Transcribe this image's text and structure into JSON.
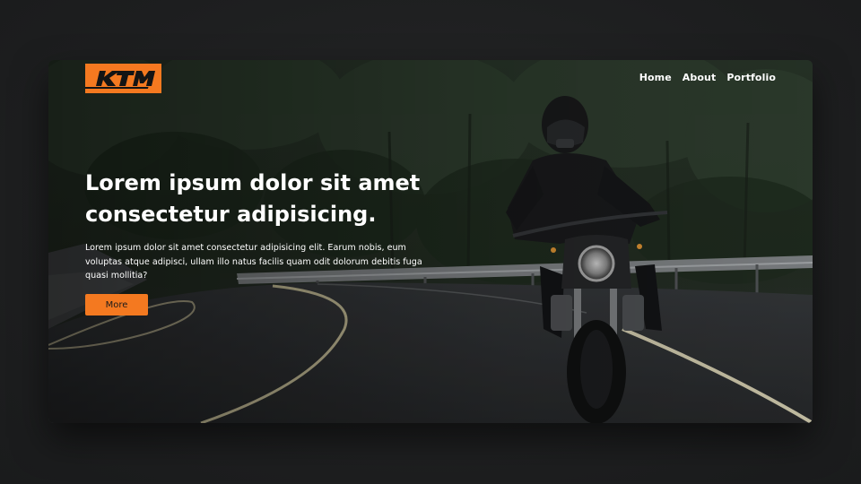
{
  "brand": {
    "logo_text": "KTM",
    "accent_color": "#f47920"
  },
  "nav": {
    "items": [
      {
        "label": "Home"
      },
      {
        "label": "About"
      },
      {
        "label": "Portfolio"
      }
    ]
  },
  "hero": {
    "headline": "Lorem ipsum dolor sit amet consectetur adipisicing.",
    "body": "Lorem ipsum dolor sit amet consectetur adipisicing elit. Earum nobis, eum voluptas atque adipisci, ullam illo natus facilis quam odit dolorum debitis fuga quasi mollitia?",
    "cta_label": "More",
    "background_image": "motorcyclist-on-forest-road"
  }
}
